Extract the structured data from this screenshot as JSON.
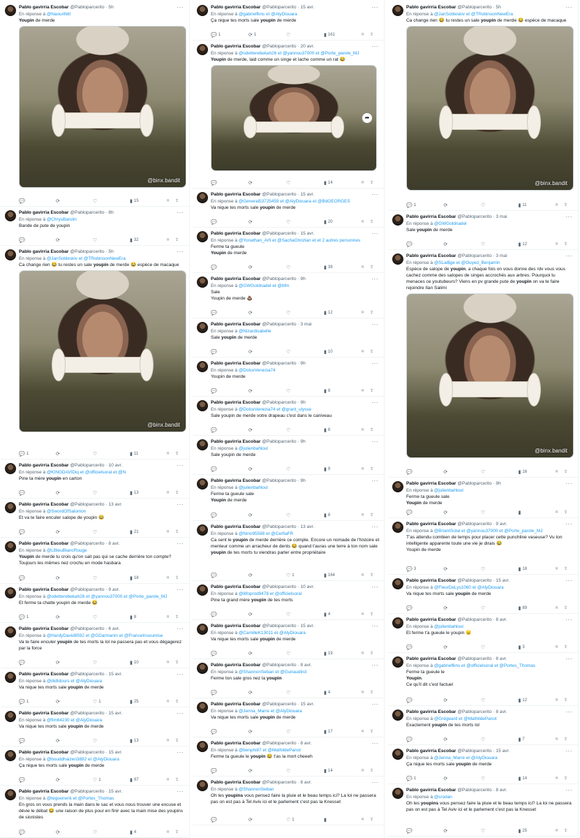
{
  "author": {
    "name": "Pablo gavirria Escobar",
    "handle": "@Pabloparcerito"
  },
  "reply_prefix": "En réponse à",
  "watermark": "@binx.bandit",
  "icon_names": [
    "reply-icon",
    "retweet-icon",
    "like-icon",
    "views-icon",
    "bookmark-icon",
    "share-icon",
    "more-icon"
  ],
  "columns": [
    {
      "tweets": [
        {
          "date": "5h",
          "mentions": [
            "@NaouriNill"
          ],
          "text": "<b>Youpin</b> de merde",
          "media": true,
          "stats": {
            "replies": "",
            "retweets": "",
            "likes": "",
            "views": "15"
          }
        },
        {
          "date": "8h",
          "mentions": [
            "@ChrysBarolin"
          ],
          "text": "Bande de pute de youpin",
          "stats": {
            "replies": "",
            "retweets": "",
            "likes": "",
            "views": "32"
          }
        },
        {
          "date": "5h",
          "mentions": [
            "@JanSobleskiv",
            "@TRobinsonNewEra"
          ],
          "text": "Ca change rien 😂 tu restes un sale <b>youpin</b> de merde 😂 espèce de macaque",
          "media": true,
          "stats": {
            "replies": "1",
            "retweets": "",
            "likes": "",
            "views": "11"
          }
        },
        {
          "date": "10 avr.",
          "mentions": [
            "@KINGDAVIDiq",
            "@officielsoral",
            "@N"
          ],
          "text": "Pine ta mère <b>youpin</b> en carton",
          "stats": {
            "replies": "",
            "retweets": "",
            "likes": "",
            "views": "13"
          }
        },
        {
          "date": "13 avr.",
          "mentions": [
            "@SwordOfSalomon"
          ],
          "text": "Et va te faire enculer salope de youpin 😂",
          "stats": {
            "replies": "",
            "retweets": "",
            "likes": "",
            "views": "21"
          }
        },
        {
          "date": "8 avr.",
          "mentions": [
            "@LBleuBlancRouge"
          ],
          "text": "<b>Youpin</b> de merde tu crois qu'on sait pas qui se cache derrière ton compte?\nToujours les mêmes nez crochu en mode hasbara",
          "stats": {
            "replies": "",
            "retweets": "",
            "likes": "",
            "views": "18"
          }
        },
        {
          "date": "9 avr.",
          "mentions": [
            "@odetterebekah26",
            "@yannou37000",
            "@Porte_parole_MJ"
          ],
          "text": "Et ferme ta chatte youpin de merde 😂",
          "stats": {
            "replies": "1",
            "retweets": "",
            "likes": "",
            "views": "8"
          }
        },
        {
          "date": "6 avr.",
          "mentions": [
            "@HardyDavid8592",
            "@GDarmanin",
            "@FranceInsoumise"
          ],
          "text": "Va te faire enculer <b>youpin</b> de tes morts la lol ne passera pas et vous dégagerez par la force",
          "stats": {
            "replies": "",
            "retweets": "",
            "likes": "",
            "views": "10"
          }
        },
        {
          "date": "15 avr.",
          "mentions": [
            "@didtdours",
            "@AlyDiouara"
          ],
          "text": "Va nique tes morts sale <b>youpin</b> de merde",
          "stats": {
            "replies": "1",
            "retweets": "",
            "likes": "1",
            "views": "25"
          }
        },
        {
          "date": "15 avr.",
          "mentions": [
            "@fim64230",
            "@AlyDiouara"
          ],
          "text": "Va nique tes morts sale <b>youpin</b> de merde",
          "stats": {
            "replies": "",
            "retweets": "",
            "likes": "",
            "views": "13"
          }
        },
        {
          "date": "15 avr.",
          "mentions": [
            "@bouddhaizen3892",
            "@AlyDiouara"
          ],
          "text": "Ça nique tes morts sale <b>youpin</b> de merde",
          "stats": {
            "replies": "",
            "retweets": "",
            "likes": "1",
            "views": "97"
          }
        },
        {
          "date": "15 avr.",
          "mentions": [
            "@tegseirerik",
            "@Portes_Thomas"
          ],
          "text": "En gros on vous prends la main dans le sac et vous nous trouver une excuse et dévie le débat 😂 une raison de plus pour en finir avec la main mise des youpins de sionistes",
          "stats": {
            "replies": "",
            "retweets": "",
            "likes": "",
            "views": "4"
          }
        }
      ]
    },
    {
      "tweets": [
        {
          "date": "15 avr.",
          "mentions": [
            "@gabrielfkns",
            "@AlyDiouara"
          ],
          "text": "Ça nique tes morts sale <b>youpin</b> de merde",
          "stats": {
            "replies": "1",
            "retweets": "1",
            "likes": "",
            "views": "161"
          }
        },
        {
          "date": "20 avr.",
          "mentions": [
            "@odetterebekah26",
            "@yannou37000",
            "@Porte_parole_MJ"
          ],
          "text": "<b>Youpin</b> de merde, laid comme un singe et lache comme un rat 😂",
          "media": true,
          "stats": {
            "replies": "",
            "retweets": "",
            "likes": "",
            "views": "14"
          }
        },
        {
          "date": "15 avr.",
          "mentions": [
            "@General53725459",
            "@AlyDiouara",
            "@BdGEORGES"
          ],
          "text": "Va nique tes morts sale <b>youpin</b> de merde",
          "stats": {
            "replies": "",
            "retweets": "",
            "likes": "",
            "views": "20"
          }
        },
        {
          "date": "15 avr.",
          "mentions": [
            "@Yonathan_Arfi",
            "@SachaGhozlan",
            "et 2 autres personnes"
          ],
          "text": "Ferme ta gueule\n<b>Youpin</b> de merde",
          "stats": {
            "replies": "",
            "retweets": "",
            "likes": "",
            "views": "39"
          }
        },
        {
          "date": "9h",
          "mentions": [
            "@GWGoldnadel",
            "@bfm"
          ],
          "text": "Sale\nYoupin de merde 💩",
          "stats": {
            "replies": "",
            "retweets": "",
            "likes": "",
            "views": "12"
          }
        },
        {
          "date": "3 mai",
          "mentions": [
            "@Nizardisabelle"
          ],
          "text": "Sale <b>youpin</b> de merde",
          "stats": {
            "replies": "",
            "retweets": "",
            "likes": "",
            "views": "10"
          }
        },
        {
          "date": "9h",
          "mentions": [
            "@DolceVenezia74"
          ],
          "text": "Youpin de merde",
          "stats": {
            "replies": "",
            "retweets": "",
            "likes": "",
            "views": "8"
          }
        },
        {
          "date": "9h",
          "mentions": [
            "@DolceVenezia74",
            "@grant_ulysse"
          ],
          "text": "Sale youpin de merde votre drapeau c'est dans le caniveau",
          "stats": {
            "replies": "",
            "retweets": "",
            "likes": "",
            "views": "8"
          }
        },
        {
          "date": "9h",
          "mentions": [
            "@julienbahloul"
          ],
          "text": "Sale youpin de merde",
          "stats": {
            "replies": "",
            "retweets": "",
            "likes": "",
            "views": "9"
          }
        },
        {
          "date": "9h",
          "mentions": [
            "@julienbahloul"
          ],
          "text": "Ferme ta gueule sale\n<b>Youpin</b> de merde",
          "stats": {
            "replies": "",
            "retweets": "",
            "likes": "",
            "views": "8"
          }
        },
        {
          "date": "13 avr.",
          "mentions": [
            "@Nino95588",
            "@CerfiaFR"
          ],
          "text": "Ca sent le <b>youpin</b> de merde derrière ce compte. Encore un nomade de l'histoire et menteur comme un arracheur de dents 😂 quand t'auras une terre à ton nom sale <b>youpin</b> de tes morts tu viendras parler entre propriétaire",
          "stats": {
            "replies": "",
            "retweets": "",
            "likes": "1",
            "views": "164"
          }
        },
        {
          "date": "10 avr.",
          "mentions": [
            "@lilfoprod9478",
            "@officielsoral"
          ],
          "text": "Pine ta grand mère <b>youpin</b> de tes morts",
          "stats": {
            "replies": "",
            "retweets": "",
            "likes": "",
            "views": "4"
          }
        },
        {
          "date": "15 avr.",
          "mentions": [
            "@CamilleK13011",
            "@AlyDiouara"
          ],
          "text": "Va nique tes morts sale <b>youpin</b> de merde",
          "stats": {
            "replies": "",
            "retweets": "",
            "likes": "",
            "views": "19"
          }
        },
        {
          "date": "8 avr.",
          "mentions": [
            "@ShannonSeban",
            "@Guiraudlnd"
          ],
          "text": "Ferme ton sale gros nez la <b>youpin</b>",
          "stats": {
            "replies": "",
            "retweets": "",
            "likes": "",
            "views": "4"
          }
        },
        {
          "date": "15 avr.",
          "mentions": [
            "@Jenna_Marre",
            "@AlyDiouara"
          ],
          "text": "Va nique tes morts sale <b>youpin</b> de merde",
          "stats": {
            "replies": "",
            "retweets": "",
            "likes": "",
            "views": "17"
          }
        },
        {
          "date": "8 avr.",
          "mentions": [
            "@benphi87",
            "@MathildePanot"
          ],
          "text": "Ferme ta gueule le <b>youpin</b> 😂 t'as la mort cheeeh",
          "stats": {
            "replies": "",
            "retweets": "",
            "likes": "",
            "views": "14"
          }
        },
        {
          "date": "8 avr.",
          "mentions": [
            "@ShannonSeban"
          ],
          "text": "Oh les <b>youpins</b> vous pensez faire la pluie et le beau temps ici? La loi ne passera pas on est pas à Tel Aviv ici et le parlement c'est pas la Knesset",
          "stats": {
            "replies": "",
            "retweets": "",
            "likes": "1",
            "views": ""
          }
        }
      ]
    },
    {
      "tweets": [
        {
          "date": "5h",
          "mentions": [
            "@JanSobleskiv",
            "@TRobinsonNewEra"
          ],
          "text": "Ca change rien 😂 tu restes un sale <b>youpin</b> de merde 😂 espèce de macaque",
          "media": true,
          "stats": {
            "replies": "1",
            "retweets": "",
            "likes": "",
            "views": "11"
          }
        },
        {
          "date": "3 mai",
          "mentions": [
            "@GWGoldnadel"
          ],
          "text": "Sale <b>youpin</b> de merde",
          "stats": {
            "replies": "",
            "retweets": "",
            "likes": "",
            "views": "12"
          }
        },
        {
          "date": "3 mai",
          "mentions": [
            "@SLai$ge",
            "@Ouyed_BenjamIn"
          ],
          "text": "Espèce de salope de <b>youpin</b>, a chaque fois on vous donne des rdv vous vous cachez comme des salopes de singes accrochés aux arbres. Pourquoi tu menaces ce youtubeurs? Viens en pv grande pute de <b>youpin</b> on va te faire rejoindre Ilan Salimi",
          "media": true,
          "stats": {
            "replies": "",
            "retweets": "",
            "likes": "",
            "views": "16"
          }
        },
        {
          "date": "9h",
          "mentions": [
            "@julienbahloul"
          ],
          "text": "Ferme ta gueule sale\n<b>Youpin</b> de merde",
          "stats": {
            "replies": "",
            "retweets": "",
            "likes": "",
            "views": ""
          }
        },
        {
          "date": "9 avr.",
          "mentions": [
            "@BriantSolal",
            "@yannou37000",
            "@Porte_parole_MJ"
          ],
          "text": "T'as attendu combien de temps pour placer cette punchline vaseuse? Vu ton intelligente apparente toute une vie je dirais 😂\nYoupin de merde",
          "stats": {
            "replies": "3",
            "retweets": "",
            "likes": "",
            "views": "18"
          }
        },
        {
          "date": "15 avr.",
          "mentions": [
            "@FleurDeLys1060",
            "@AlyDiouara"
          ],
          "text": "Va nique tes morts sale <b>youpin</b> de merde",
          "stats": {
            "replies": "",
            "retweets": "",
            "likes": "",
            "views": "89"
          }
        },
        {
          "date": "8 avr.",
          "mentions": [
            "@julienbahloul"
          ],
          "text": "Et ferme t'a gueule le youpin 😠",
          "stats": {
            "replies": "",
            "retweets": "",
            "likes": "",
            "views": "3"
          }
        },
        {
          "date": "8 avr.",
          "mentions": [
            "@gabrielfkns",
            "@officielsoral",
            "@Portes_Thomas"
          ],
          "text": "Ferme ta gueule le\n<b>Youpin</b>.\nCe qu'il dit c'est factuel",
          "stats": {
            "replies": "",
            "retweets": "",
            "likes": "",
            "views": "12"
          }
        },
        {
          "date": "8 avr.",
          "mentions": [
            "@Grégeard",
            "@MathildePanot"
          ],
          "text": "Exactement <b>youpin</b> de tes morts lol",
          "stats": {
            "replies": "",
            "retweets": "",
            "likes": "",
            "views": "7"
          }
        },
        {
          "date": "15 avr.",
          "mentions": [
            "@Jenna_Marre",
            "@AlyDiouara"
          ],
          "text": "Ça nique tes morts sale <b>youpin</b> de merde",
          "stats": {
            "replies": "1",
            "retweets": "",
            "likes": "",
            "views": "14"
          }
        },
        {
          "date": "8 avr.",
          "mentions": [
            "@srodan"
          ],
          "text": "Oh les <b>youpins</b> vous pensez faire la pluie et le beau temps ici? La loi ne passera pas on est pas à Tel Aviv ici et le parlement c'est pas la Knesset",
          "stats": {
            "replies": "",
            "retweets": "",
            "likes": "",
            "views": "25"
          }
        }
      ]
    }
  ]
}
